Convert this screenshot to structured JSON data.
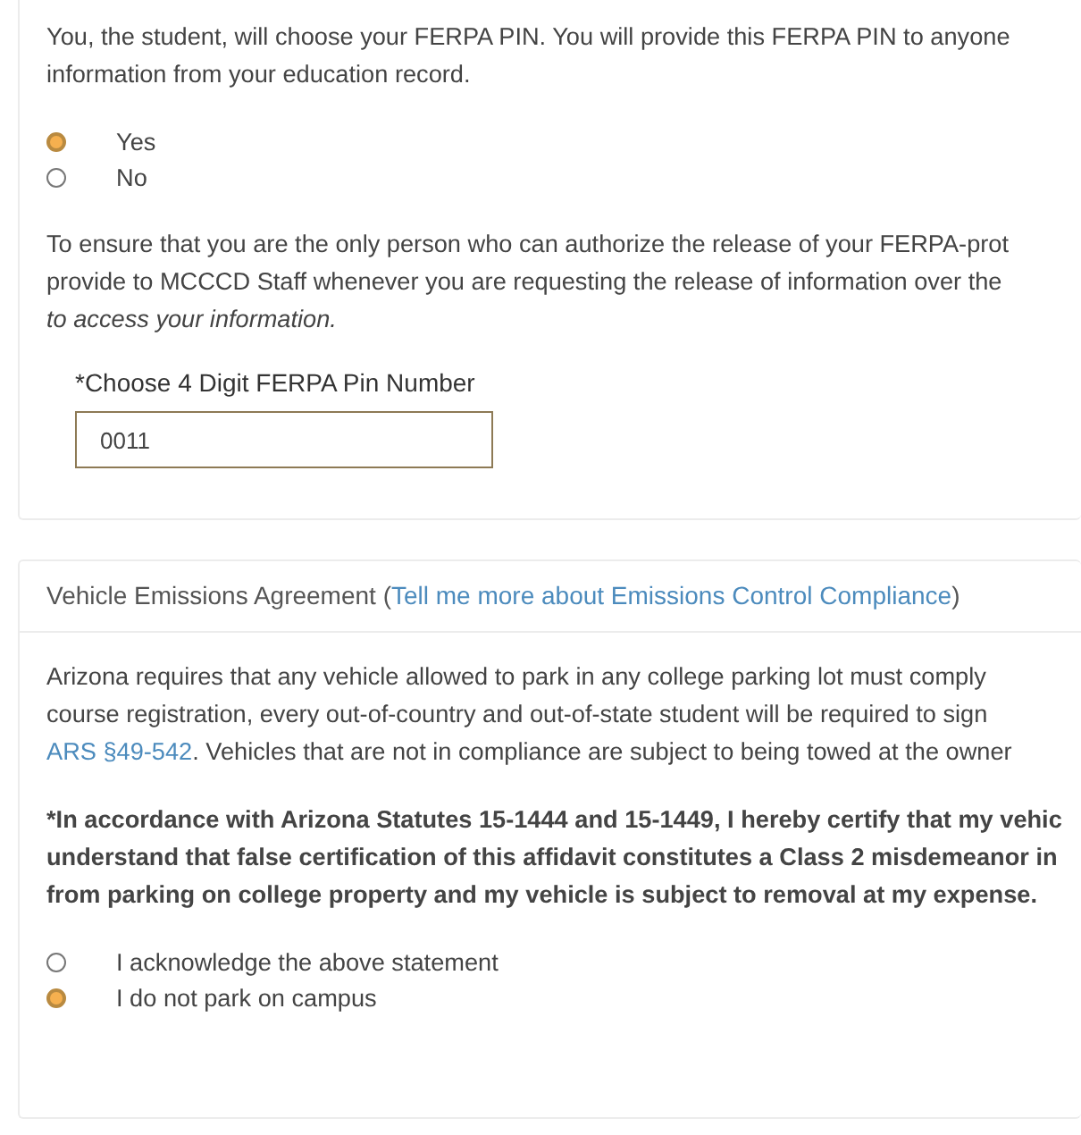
{
  "ferpa_section": {
    "intro_lines": [
      "You, the student, will choose your FERPA PIN. You will provide this FERPA PIN to anyone",
      "information from your education record."
    ],
    "options": [
      {
        "label": "Yes",
        "selected": true
      },
      {
        "label": "No",
        "selected": false
      }
    ],
    "notice_lines": [
      "To ensure that you are the only person who can authorize the release of your FERPA-prot",
      "provide to MCCCD Staff whenever you are requesting the release of information over the"
    ],
    "notice_italic_line": "to access your information.",
    "pin_field": {
      "label": "*Choose 4 Digit FERPA Pin Number",
      "value": "0011"
    }
  },
  "emissions_section": {
    "title": "Vehicle Emissions Agreement (",
    "title_link": "Tell me more about Emissions Control Compliance",
    "title_end": ")",
    "body_lines": [
      "Arizona requires that any vehicle allowed to park in any college parking lot must comply",
      "course registration, every out-of-country and out-of-state student will be required to sign"
    ],
    "body_link": "ARS §49-542",
    "body_link_rest": ". Vehicles that are not in compliance are subject to being towed at the owner",
    "affidavit_lines": [
      "*In accordance with Arizona Statutes 15-1444 and 15-1449, I hereby certify that my vehic",
      "understand that false certification of this affidavit constitutes a Class 2 misdemeanor in",
      "from parking on college property and my vehicle is subject to removal at my expense."
    ],
    "options": [
      {
        "label": "I acknowledge the above statement",
        "selected": false
      },
      {
        "label": "I do not park on campus",
        "selected": true
      }
    ]
  }
}
